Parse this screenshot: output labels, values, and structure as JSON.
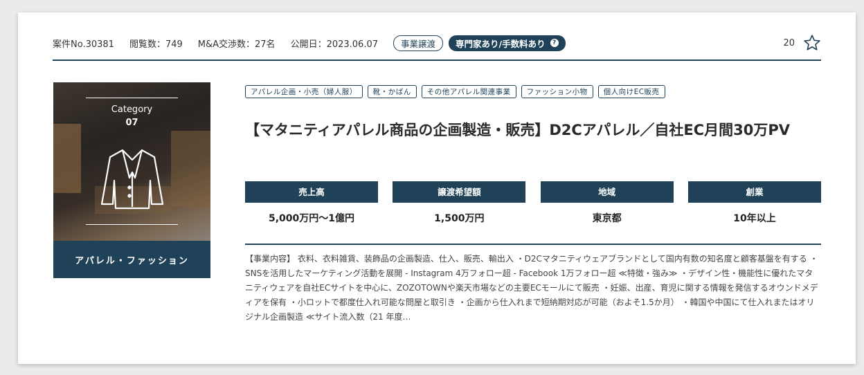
{
  "meta": {
    "case_no": "案件No.30381",
    "views": "閲覧数：749",
    "negotiations": "M&A交渉数：27名",
    "published": "公開日：2023.06.07",
    "badge_type": "事業譲渡",
    "badge_expert": "専門家あり/手数料あり",
    "help_icon": "?",
    "favorite_count": "20"
  },
  "thumbnail": {
    "category_label": "Category",
    "category_number": "07",
    "caption": "アパレル・ファッション",
    "icon": "jacket-icon"
  },
  "tags": [
    "アパレル企画・小売（婦人服）",
    "靴・かばん",
    "その他アパレル関連事業",
    "ファッション小物",
    "個人向けEC販売"
  ],
  "title": "【マタニティアパレル商品の企画製造・販売】D2Cアパレル／自社EC月間30万PV",
  "stats": [
    {
      "label": "売上高",
      "value": "5,000万円〜1億円"
    },
    {
      "label": "譲渡希望額",
      "value": "1,500万円"
    },
    {
      "label": "地域",
      "value": "東京都"
    },
    {
      "label": "創業",
      "value": "10年以上"
    }
  ],
  "description": "【事業内容】 衣料、衣料雑貨、装飾品の企画製造、仕入、販売、輸出入 ・D2Cマタニティウェアブランドとして国内有数の知名度と顧客基盤を有する ・SNSを活用したマーケティング活動を展開 - Instagram 4万フォロー超 - Facebook 1万フォロー超 ≪特徴・強み≫ ・デザイン性・機能性に優れたマタニティウェアを自社ECサイトを中心に、ZOZOTOWNや楽天市場などの主要ECモールにて販売 ・妊娠、出産、育児に関する情報を発信するオウンドメディアを保有 ・小ロットで都度仕入れ可能な問屋と取引き ・企画から仕入れまで短納期対応が可能（およそ1.5か月） ・韓国や中国にて仕入れまたはオリジナル企画製造 ≪サイト流入数（21 年度…",
  "colors": {
    "navy": "#1f4258",
    "background": "#ebebeb"
  }
}
